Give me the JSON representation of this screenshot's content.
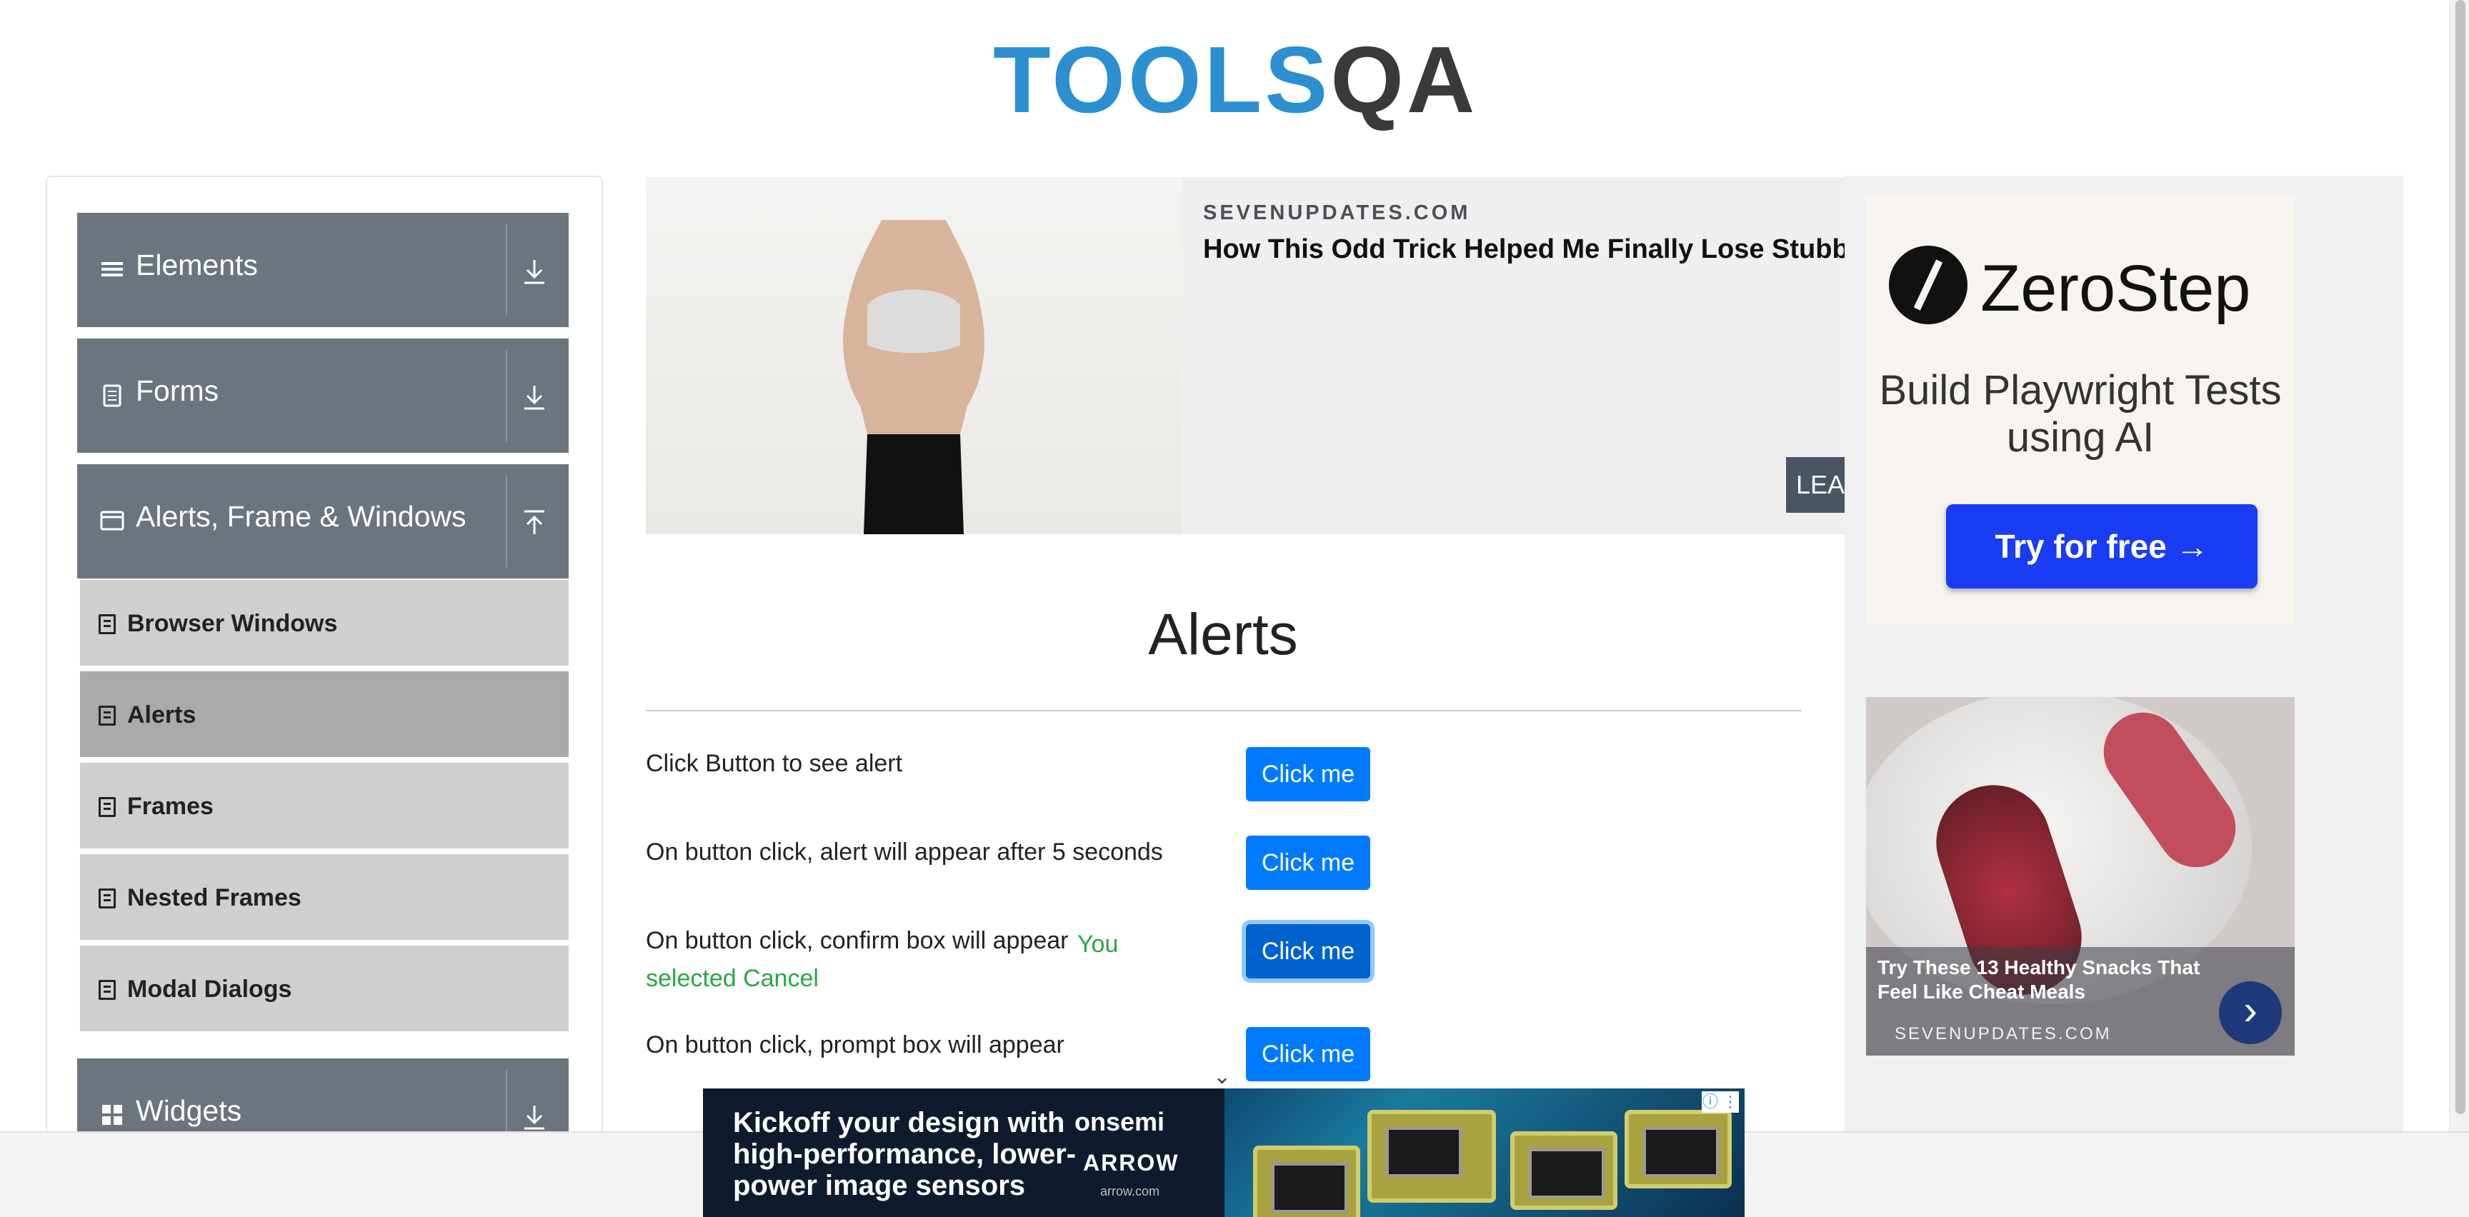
{
  "header": {
    "logo_text_main": "TOOLS",
    "logo_text_accent": "QA"
  },
  "nav": {
    "groups": [
      {
        "title": "Elements",
        "icon": "menu-icon",
        "arrow": "download-arrow-icon"
      },
      {
        "title": "Forms",
        "icon": "document-icon",
        "arrow": "download-arrow-icon"
      },
      {
        "title": "Alerts, Frame & Windows",
        "icon": "window-icon",
        "arrow": "upload-arrow-icon"
      },
      {
        "title": "Widgets",
        "icon": "grid-icon",
        "arrow": "download-arrow-icon"
      }
    ],
    "items": [
      {
        "label": "Browser Windows",
        "active": false
      },
      {
        "label": "Alerts",
        "active": true
      },
      {
        "label": "Frames",
        "active": false
      },
      {
        "label": "Nested Frames",
        "active": false
      },
      {
        "label": "Modal Dialogs",
        "active": false
      }
    ]
  },
  "banner": {
    "domain": "SEVENUPDATES.COM",
    "headline": "How This Odd Trick Helped Me Finally Lose Stubborn",
    "cta": "LEA"
  },
  "right_ad": {
    "brand": "ZeroStep",
    "tagline": "Build Playwright Tests using AI",
    "button": "Try for free →",
    "snack_title": "Try These 13 Healthy Snacks That Feel Like Cheat Meals",
    "snack_domain": "SEVENUPDATES.COM",
    "snack_arrow": "›"
  },
  "main": {
    "title": "Alerts",
    "rows": [
      {
        "text": "Click Button to see alert",
        "button": "Click me"
      },
      {
        "text": "On button click, alert will appear after 5 seconds",
        "button": "Click me"
      },
      {
        "text": "On button click, confirm box will appear",
        "button": "Click me",
        "result": "You selected Cancel"
      },
      {
        "text": "On button click, prompt box will appear",
        "button": "Click me"
      }
    ]
  },
  "bottom_ad": {
    "text": "Kickoff your design with high-performance, lower-power image sensors",
    "brand1": "onsemi",
    "brand2": "ARROW",
    "brand3": "arrow.com",
    "adchoice": "ⓘ ⋮"
  },
  "colors": {
    "nav_group_bg": "#6c757d",
    "nav_item_bg": "#cfcfcf",
    "nav_item_active_bg": "#aaaaaa",
    "button_primary": "#007bff",
    "result_text": "#28a745",
    "logo_blue": "#2b8fd0"
  }
}
